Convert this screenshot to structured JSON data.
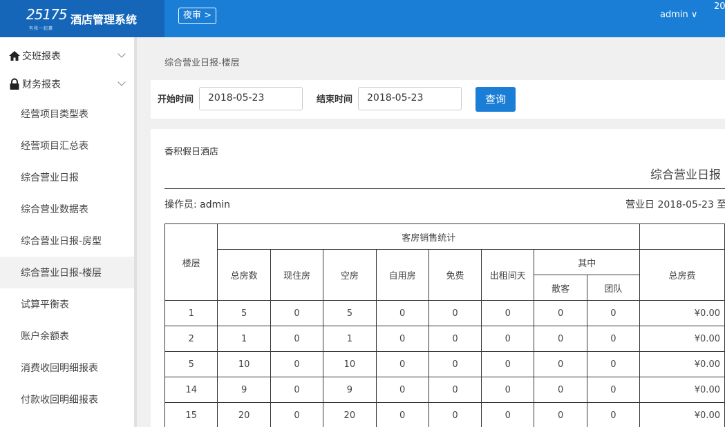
{
  "header": {
    "logo_text": "25175",
    "logo_tagline": "有我一起赢",
    "app_title": "酒店管理系统",
    "night_audit_label": "夜审 >",
    "user_label": "admin ∨",
    "clock_fragment": "20",
    "colors": {
      "topbar": "#1a7ed6",
      "logo_bg": "#1565b8"
    }
  },
  "sidebar": {
    "groups": [
      {
        "label": "交班报表",
        "icon": "home-icon"
      },
      {
        "label": "财务报表",
        "icon": "lock-icon"
      }
    ],
    "items": [
      {
        "label": "经营项目类型表"
      },
      {
        "label": "经营项目汇总表"
      },
      {
        "label": "综合营业日报"
      },
      {
        "label": "综合营业数据表"
      },
      {
        "label": "综合营业日报-房型"
      },
      {
        "label": "综合营业日报-楼层",
        "active": true
      },
      {
        "label": "试算平衡表"
      },
      {
        "label": "账户余额表"
      },
      {
        "label": "消费收回明细报表"
      },
      {
        "label": "付款收回明细报表"
      }
    ]
  },
  "main": {
    "breadcrumb": "综合营业日报-楼层",
    "filter": {
      "start_label": "开始时间",
      "start_value": "2018-05-23",
      "end_label": "结束时间",
      "end_value": "2018-05-23",
      "query_label": "查询"
    },
    "report": {
      "hotel": "香积假日酒店",
      "title": "综合营业日报",
      "operator": "操作员: admin",
      "business_date": "营业日 2018-05-23 至",
      "headers": {
        "floor": "楼层",
        "room_sales": "客房销售统计",
        "total_rooms": "总房数",
        "occupied": "现住房",
        "vacant": "空房",
        "self_use": "自用房",
        "free": "免费",
        "rented_days": "出租间天",
        "among": "其中",
        "walkin": "散客",
        "group": "团队",
        "total_fee": "总房费"
      },
      "rows": [
        {
          "floor": "1",
          "total": "5",
          "occupied": "0",
          "vacant": "5",
          "self_use": "0",
          "free": "0",
          "rented": "0",
          "walkin": "0",
          "group": "0",
          "fee": "¥0.00"
        },
        {
          "floor": "2",
          "total": "1",
          "occupied": "0",
          "vacant": "1",
          "self_use": "0",
          "free": "0",
          "rented": "0",
          "walkin": "0",
          "group": "0",
          "fee": "¥0.00"
        },
        {
          "floor": "5",
          "total": "10",
          "occupied": "0",
          "vacant": "10",
          "self_use": "0",
          "free": "0",
          "rented": "0",
          "walkin": "0",
          "group": "0",
          "fee": "¥0.00"
        },
        {
          "floor": "14",
          "total": "9",
          "occupied": "0",
          "vacant": "9",
          "self_use": "0",
          "free": "0",
          "rented": "0",
          "walkin": "0",
          "group": "0",
          "fee": "¥0.00"
        },
        {
          "floor": "15",
          "total": "20",
          "occupied": "0",
          "vacant": "20",
          "self_use": "0",
          "free": "0",
          "rented": "0",
          "walkin": "0",
          "group": "0",
          "fee": "¥0.00"
        }
      ]
    }
  }
}
